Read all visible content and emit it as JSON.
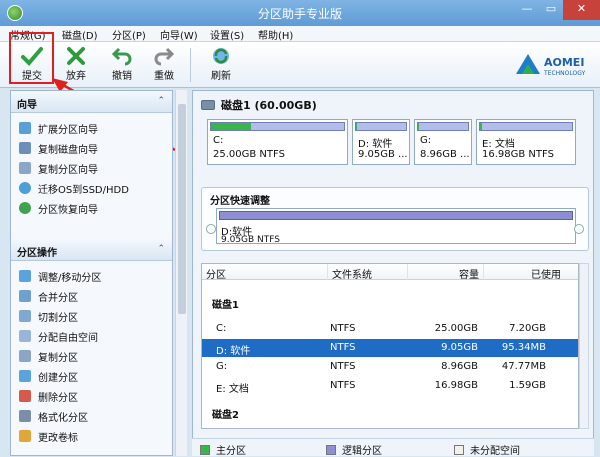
{
  "window": {
    "title": "分区助手专业版",
    "min": "—",
    "max": "▭",
    "close": "✕"
  },
  "menu": [
    "常规(G)",
    "磁盘(D)",
    "分区(P)",
    "向导(W)",
    "设置(S)",
    "帮助(H)"
  ],
  "toolbar": {
    "commit": "提交",
    "discard": "放弃",
    "undo": "撤销",
    "redo": "重做",
    "refresh": "刷新"
  },
  "logo": {
    "name": "AOMEI",
    "sub": "TECHNOLOGY"
  },
  "sidebar": {
    "wizard_title": "向导",
    "wizard_items": [
      "扩展分区向导",
      "复制磁盘向导",
      "复制分区向导",
      "迁移OS到SSD/HDD",
      "分区恢复向导"
    ],
    "ops_title": "分区操作",
    "ops_items": [
      "调整/移动分区",
      "合并分区",
      "切割分区",
      "分配自由空间",
      "复制分区",
      "创建分区",
      "删除分区",
      "格式化分区",
      "更改卷标"
    ]
  },
  "disk": {
    "title": "磁盘1 (60.00GB)",
    "partitions": [
      {
        "name": "C:",
        "info": "25.00GB NTFS",
        "fill_pct": 30
      },
      {
        "name": "D: 软件",
        "info": "9.05GB ...",
        "fill_pct": 2
      },
      {
        "name": "G:",
        "info": "8.96GB ...",
        "fill_pct": 2
      },
      {
        "name": "E: 文档",
        "info": "16.98GB NTFS",
        "fill_pct": 2
      }
    ]
  },
  "quick": {
    "title": "分区快速调整",
    "name": "D:软件",
    "info": "9.05GB NTFS"
  },
  "table": {
    "headers": [
      "分区",
      "文件系统",
      "容量",
      "已使用"
    ],
    "group1": "磁盘1",
    "rows": [
      [
        "C:",
        "NTFS",
        "25.00GB",
        "7.20GB"
      ],
      [
        "D: 软件",
        "NTFS",
        "9.05GB",
        "95.34MB"
      ],
      [
        "G:",
        "NTFS",
        "8.96GB",
        "47.77MB"
      ],
      [
        "E: 文档",
        "NTFS",
        "16.98GB",
        "1.59GB"
      ]
    ],
    "group2": "磁盘2"
  },
  "legend": {
    "primary": "主分区",
    "logical": "逻辑分区",
    "unallocated": "未分配空间"
  },
  "colors": {
    "primary": "#39b54a",
    "logical": "#8c8fd2",
    "selection": "#1f6cc6",
    "highlight": "#e02020"
  }
}
